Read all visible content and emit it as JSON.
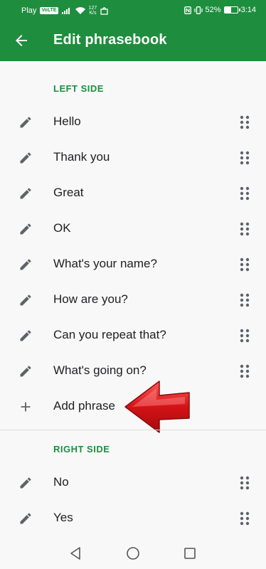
{
  "status_bar": {
    "carrier": "Play",
    "volte": "VoLTE",
    "speed": "127",
    "speed_unit": "K/s",
    "battery": "52%",
    "time": "3:14"
  },
  "app_bar": {
    "title": "Edit phrasebook",
    "back_icon": "arrow-back-icon"
  },
  "left_side": {
    "header": "LEFT SIDE",
    "phrases": [
      "Hello",
      "Thank you",
      "Great",
      "OK",
      "What's your name?",
      "How are you?",
      "Can you repeat that?",
      "What's going on?"
    ],
    "add_label": "Add phrase"
  },
  "right_side": {
    "header": "RIGHT SIDE",
    "phrases": [
      "No",
      "Yes"
    ]
  },
  "colors": {
    "primary": "#1e8e3e",
    "text": "#202124",
    "icon": "#5f6368",
    "pointer": "#d31216"
  },
  "icons": {
    "edit": "pencil-icon",
    "drag": "drag-handle-icon",
    "add": "plus-icon",
    "nav_back": "triangle-back-icon",
    "nav_home": "circle-home-icon",
    "nav_recents": "square-recents-icon"
  }
}
